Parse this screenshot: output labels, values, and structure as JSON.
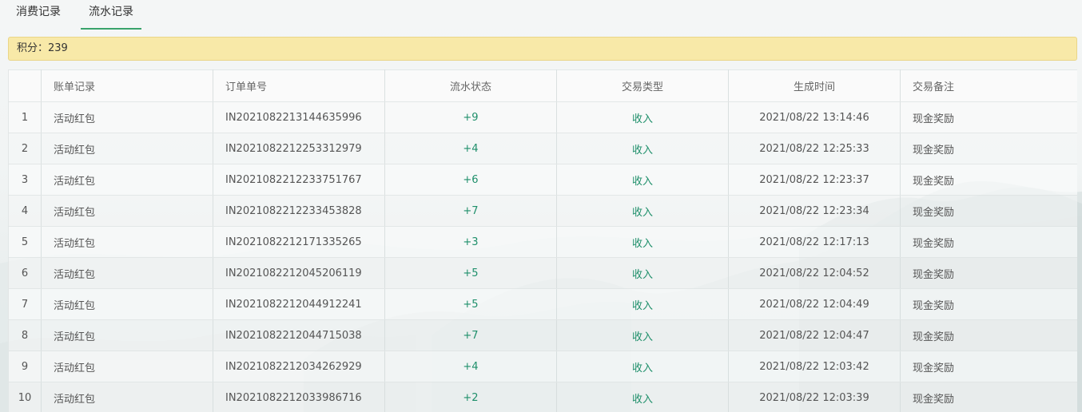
{
  "tabs": [
    {
      "label": "消费记录",
      "active": false
    },
    {
      "label": "流水记录",
      "active": true
    }
  ],
  "points": {
    "label": "积分：",
    "value": "239"
  },
  "table": {
    "headers": [
      "",
      "账单记录",
      "订单单号",
      "流水状态",
      "交易类型",
      "生成时间",
      "交易备注"
    ],
    "rows": [
      {
        "index": "1",
        "record": "活动红包",
        "order_no": "IN2021082213144635996",
        "change": "+9",
        "type": "收入",
        "time": "2021/08/22 13:14:46",
        "note": "现金奖励"
      },
      {
        "index": "2",
        "record": "活动红包",
        "order_no": "IN2021082212253312979",
        "change": "+4",
        "type": "收入",
        "time": "2021/08/22 12:25:33",
        "note": "现金奖励"
      },
      {
        "index": "3",
        "record": "活动红包",
        "order_no": "IN2021082212233751767",
        "change": "+6",
        "type": "收入",
        "time": "2021/08/22 12:23:37",
        "note": "现金奖励"
      },
      {
        "index": "4",
        "record": "活动红包",
        "order_no": "IN2021082212233453828",
        "change": "+7",
        "type": "收入",
        "time": "2021/08/22 12:23:34",
        "note": "现金奖励"
      },
      {
        "index": "5",
        "record": "活动红包",
        "order_no": "IN2021082212171335265",
        "change": "+3",
        "type": "收入",
        "time": "2021/08/22 12:17:13",
        "note": "现金奖励"
      },
      {
        "index": "6",
        "record": "活动红包",
        "order_no": "IN2021082212045206119",
        "change": "+5",
        "type": "收入",
        "time": "2021/08/22 12:04:52",
        "note": "现金奖励"
      },
      {
        "index": "7",
        "record": "活动红包",
        "order_no": "IN2021082212044912241",
        "change": "+5",
        "type": "收入",
        "time": "2021/08/22 12:04:49",
        "note": "现金奖励"
      },
      {
        "index": "8",
        "record": "活动红包",
        "order_no": "IN2021082212044715038",
        "change": "+7",
        "type": "收入",
        "time": "2021/08/22 12:04:47",
        "note": "现金奖励"
      },
      {
        "index": "9",
        "record": "活动红包",
        "order_no": "IN2021082212034262929",
        "change": "+4",
        "type": "收入",
        "time": "2021/08/22 12:03:42",
        "note": "现金奖励"
      },
      {
        "index": "10",
        "record": "活动红包",
        "order_no": "IN2021082212033986716",
        "change": "+2",
        "type": "收入",
        "time": "2021/08/22 12:03:39",
        "note": "现金奖励"
      }
    ]
  },
  "colors": {
    "accent": "#3aa36b",
    "value_green": "#1e8f6a",
    "points_bg": "#f8e9a8"
  }
}
